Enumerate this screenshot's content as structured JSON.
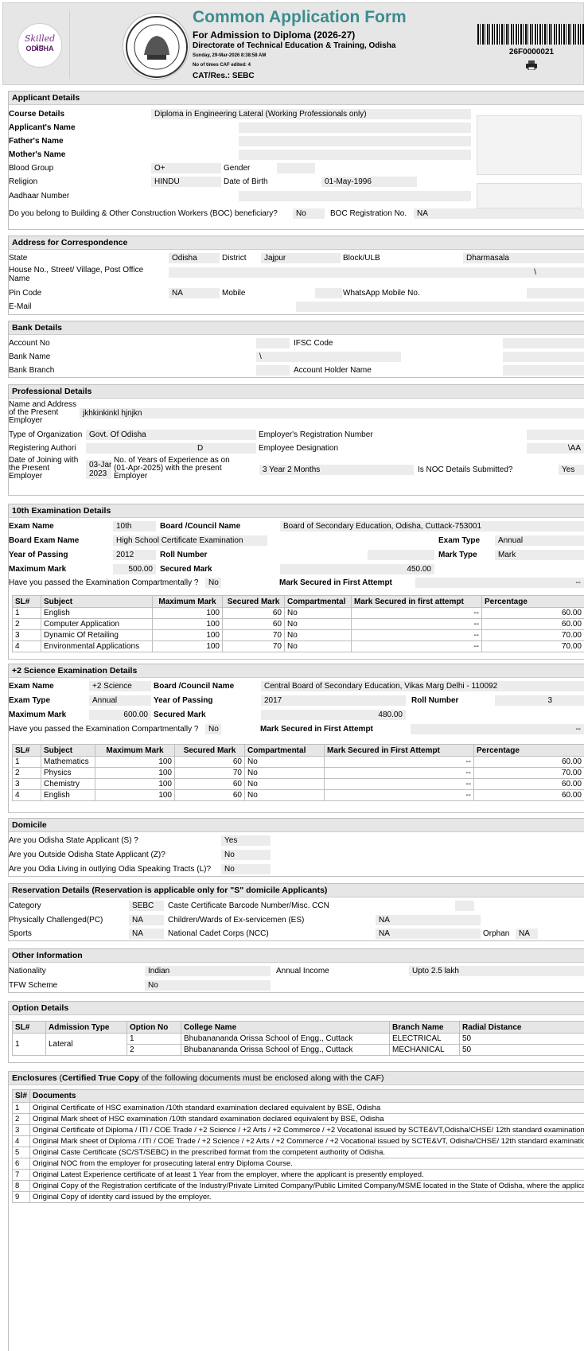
{
  "header": {
    "title": "Common Application Form",
    "subtitle": "For Admission to Diploma (2026-27)",
    "directorate": "Directorate of Technical Education & Training, Odisha",
    "datetime": "Sunday, 29-Mar-2026 8:38:58 AM",
    "cafs_edited": "No of times CAF edited: 4",
    "cat": "CAT/Res.: SEBC",
    "barcode_number": "26F0000021",
    "logo_text1": "Skilled in",
    "logo_text2": "ODISHA"
  },
  "applicant": {
    "heading": "Applicant Details",
    "course_label": "Course Details",
    "course_value": "Diploma in Engineering Lateral (Working Professionals only)",
    "name_label": "Applicant's Name",
    "father_label": "Father's Name",
    "mother_label": "Mother's Name",
    "blood_label": "Blood Group",
    "blood_value": "O+",
    "gender_label": "Gender",
    "religion_label": "Religion",
    "religion_value": "HINDU",
    "dob_label": "Date of Birth",
    "dob_value": "01-May-1996",
    "aadhaar_label": "Aadhaar Number",
    "boc_q": "Do you belong to Building & Other Construction Workers (BOC) beneficiary?",
    "boc_value": "No",
    "bocreg_label": "BOC Registration No.",
    "bocreg_value": "NA"
  },
  "address": {
    "heading": "Address for Correspondence",
    "state_label": "State",
    "state_value": "Odisha",
    "district_label": "District",
    "district_value": "Jajpur",
    "block_label": "Block/ULB",
    "block_value": "Dharmasala",
    "house_label1": "House No., Street/ Village, Post Office",
    "house_label2": "Name",
    "house_value": "\\",
    "pin_label": "Pin Code",
    "pin_value": "NA",
    "mobile_label": "Mobile",
    "wa_label": "WhatsApp Mobile No.",
    "email_label": "E-Mail"
  },
  "bank": {
    "heading": "Bank Details",
    "acc_label": "Account No",
    "ifsc_label": "IFSC Code",
    "name_label": "Bank Name",
    "name_value": "\\",
    "branch_label": "Bank Branch",
    "holder_label": "Account Holder Name"
  },
  "prof": {
    "heading": "Professional Details",
    "addr_l1": "Name and Address",
    "addr_l2": "of the Present",
    "addr_l3": "Employer",
    "addr_value": "jkhkinkinkl hjnjkn",
    "org_label": "Type of Organization",
    "org_value": "Govt. Of Odisha",
    "empreg_label": "Employer's Registration Number",
    "regauth_label": "Registering Authori",
    "regauth_value": "D",
    "desig_label": "Employee Designation",
    "desig_value": "\\AA",
    "doj_l1": "Date of Joining with",
    "doj_l2": "the Present",
    "doj_l3": "Employer",
    "doj_v1": "03-Jan-",
    "doj_v2": "2023",
    "years_l1": "No. of Years of Experience as on",
    "years_l2": "(01-Apr-2025) with the present",
    "years_l3": "Employer",
    "years_value": "3 Year 2 Months",
    "noc_label": "Is NOC Details Submitted?",
    "noc_value": "Yes"
  },
  "tenth": {
    "heading": "10th Examination Details",
    "exam_label": "Exam Name",
    "exam_value": "10th",
    "board_label": "Board /Council Name",
    "board_value": "Board of Secondary Education, Odisha, Cuttack-753001",
    "bexam_label": "Board Exam Name",
    "bexam_value": "High School Certificate Examination",
    "etype_label": "Exam Type",
    "etype_value": "Annual",
    "yop_label": "Year of Passing",
    "yop_value": "2012",
    "roll_label": "Roll Number",
    "mtype_label": "Mark Type",
    "mtype_value": "Mark",
    "max_label": "Maximum Mark",
    "max_value": "500.00",
    "sec_label": "Secured Mark",
    "sec_value": "450.00",
    "comp_q": "Have you passed the Examination Compartmentally ?",
    "comp_value": "No",
    "first_label": "Mark Secured in First Attempt",
    "first_value": "--",
    "cols": [
      "SL#",
      "Subject",
      "Maximum Mark",
      "Secured Mark",
      "Compartmental",
      "Mark Secured in first attempt",
      "Percentage"
    ],
    "rows": [
      [
        "1",
        "English",
        "100",
        "60",
        "No",
        "--",
        "60.00"
      ],
      [
        "2",
        "Computer Application",
        "100",
        "60",
        "No",
        "--",
        "60.00"
      ],
      [
        "3",
        "Dynamic Of Retailing",
        "100",
        "70",
        "No",
        "--",
        "70.00"
      ],
      [
        "4",
        "Environmental Applications",
        "100",
        "70",
        "No",
        "--",
        "70.00"
      ]
    ]
  },
  "plus2": {
    "heading": "+2 Science Examination Details",
    "exam_label": "Exam Name",
    "exam_value": "+2 Science",
    "board_label": "Board /Council Name",
    "board_value": "Central Board of Secondary Education, Vikas Marg Delhi - 110092",
    "etype_label": "Exam Type",
    "etype_value": "Annual",
    "yop_label": "Year of Passing",
    "yop_value": "2017",
    "roll_label": "Roll Number",
    "roll_value": "3",
    "max_label": "Maximum Mark",
    "max_value": "600.00",
    "sec_label": "Secured Mark",
    "sec_value": "480.00",
    "comp_q": "Have you passed the Examination Compartmentally ?",
    "comp_value": "No",
    "first_label": "Mark Secured in First Attempt",
    "first_value": "--",
    "cols": [
      "SL#",
      "Subject",
      "Maximum Mark",
      "Secured Mark",
      "Compartmental",
      "Mark Secured in First Attempt",
      "Percentage"
    ],
    "rows": [
      [
        "1",
        "Mathematics",
        "100",
        "60",
        "No",
        "--",
        "60.00"
      ],
      [
        "2",
        "Physics",
        "100",
        "70",
        "No",
        "--",
        "70.00"
      ],
      [
        "3",
        "Chemistry",
        "100",
        "60",
        "No",
        "--",
        "60.00"
      ],
      [
        "4",
        "English",
        "100",
        "60",
        "No",
        "--",
        "60.00"
      ]
    ]
  },
  "domicile": {
    "heading": "Domicile",
    "q1": "Are you Odisha State Applicant (S) ?",
    "a1": "Yes",
    "q2": "Are you Outside Odisha State Applicant (Z)?",
    "a2": "No",
    "q3": "Are you Odia Living in outlying Odia Speaking Tracts (L)?",
    "a3": "No"
  },
  "reservation": {
    "heading": "Reservation Details (Reservation is applicable only for \"S\" domicile Applicants)",
    "cat_label": "Category",
    "cat_value": "SEBC",
    "caste_label": "Caste Certificate Barcode Number/Misc. CCN",
    "pc_label": "Physically Challenged(PC)",
    "pc_value": "NA",
    "es_label": "Children/Wards of Ex-servicemen (ES)",
    "es_value": "NA",
    "sports_label": "Sports",
    "sports_value": "NA",
    "ncc_label": "National Cadet Corps (NCC)",
    "ncc_value": "NA",
    "orphan_label": "Orphan",
    "orphan_value": "NA"
  },
  "other": {
    "heading": "Other Information",
    "nat_label": "Nationality",
    "nat_value": "Indian",
    "income_label": "Annual Income",
    "income_value": "Upto 2.5 lakh",
    "tfw_label": "TFW Scheme",
    "tfw_value": "No"
  },
  "options": {
    "heading": "Option Details",
    "cols": [
      "SL#",
      "Admission Type",
      "Option No",
      "College Name",
      "Branch Name",
      "Radial Distance"
    ],
    "sl": "1",
    "type": "Lateral",
    "rows": [
      [
        "1",
        "Bhubanananda Orissa School of Engg., Cuttack",
        "ELECTRICAL",
        "50"
      ],
      [
        "2",
        "Bhubanananda Orissa School of Engg., Cuttack",
        "MECHANICAL",
        "50"
      ]
    ]
  },
  "enclosures": {
    "heading_b": "Enclosures",
    "heading_mid": "(",
    "heading_c": "Certified True Copy",
    "heading_rest": "of the following documents must be enclosed along with the CAF)",
    "cols": [
      "Sl#",
      "Documents"
    ],
    "rows": [
      [
        "1",
        "Original Certificate of HSC examination /10th standard examination declared equivalent by BSE, Odisha"
      ],
      [
        "2",
        "Original Mark sheet of HSC examination /10th standard examination declared equivalent by BSE, Odisha"
      ],
      [
        "3",
        "Original Certificate of Diploma / ITI / COE Trade / +2 Science / +2 Arts / +2 Commerce / +2 Vocational issued by SCTE&VT,Odisha/CHSE/ 12th standard examination declared equivalent by CHSE, Odisha"
      ],
      [
        "4",
        "Original Mark sheet of Diploma / ITI / COE Trade / +2 Science / +2 Arts / +2 Commerce / +2 Vocational issued by SCTE&VT, Odisha/CHSE/ 12th standard examination declared equivalent by CHSE, Odisha"
      ],
      [
        "5",
        "Original Caste Certificate (SC/ST/SEBC) in the prescribed format from the competent authority of Odisha."
      ],
      [
        "6",
        "Original NOC from the employer for prosecuting lateral entry Diploma Course."
      ],
      [
        "7",
        "Original Latest Experience certificate of at least 1 Year from the employer, where the applicant is presently employed."
      ],
      [
        "8",
        "Original Copy of the Registration certificate of the Industry/Private Limited Company/Public Limited Company/MSME located in the State of Odisha, where the applicant has been employed."
      ],
      [
        "9",
        "Original Copy of identity card issued by the employer."
      ]
    ]
  }
}
